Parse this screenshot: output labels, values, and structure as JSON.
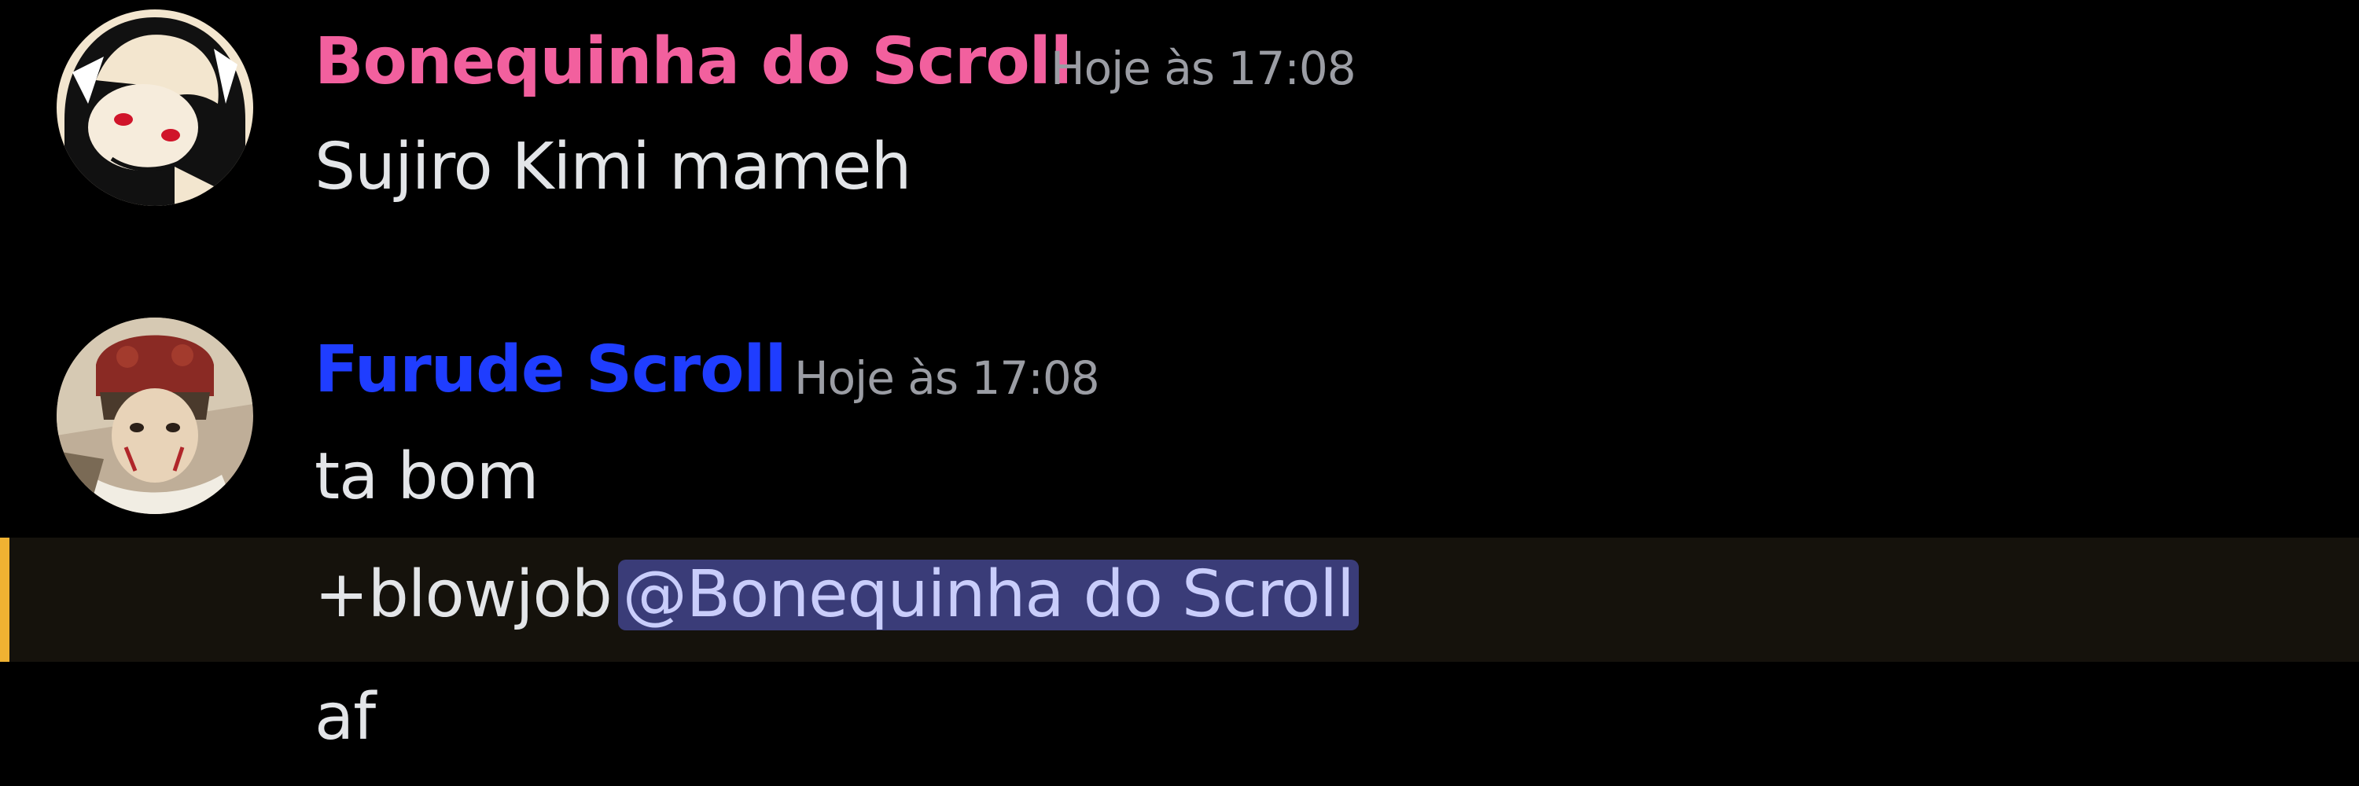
{
  "colors": {
    "background": "#000000",
    "username_1": "#f2609e",
    "username_2": "#1f3dff",
    "timestamp": "#9b9da4",
    "message_text": "#e3e5e8",
    "mention_bg": "#3a3c78",
    "mention_text": "#c9cdfb",
    "highlight_bg": "#15120c",
    "highlight_bar": "#f0b232"
  },
  "messages": [
    {
      "avatar_icon": "anime-avatar-icon",
      "username": "Bonequinha do Scroll",
      "timestamp": "Hoje às 17:08",
      "lines": [
        "Sujiro Kimi mameh"
      ]
    },
    {
      "avatar_icon": "anime-avatar-icon",
      "username": "Furude Scroll",
      "timestamp": "Hoje às 17:08",
      "lines": [
        "ta bom",
        "+blowjob",
        "af"
      ],
      "mention": "@Bonequinha do Scroll"
    }
  ]
}
